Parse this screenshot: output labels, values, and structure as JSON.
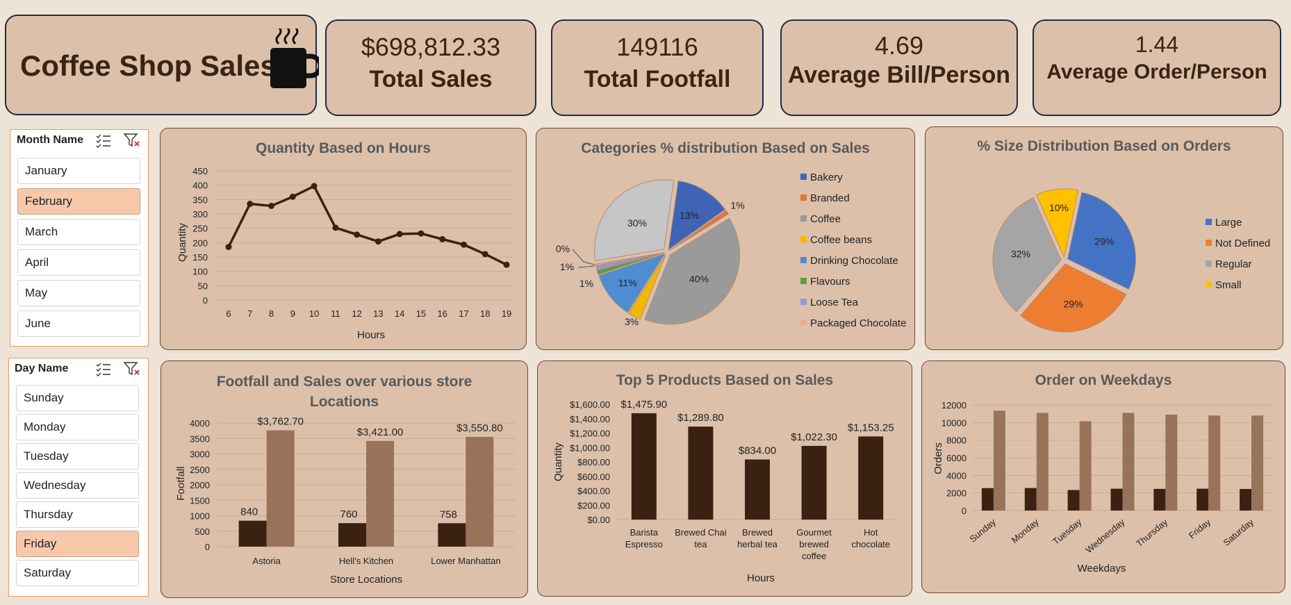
{
  "header": {
    "title": "Coffee Shop Sales",
    "icon": "coffee-mug-icon"
  },
  "kpis": {
    "total_sales": {
      "value": "$698,812.33",
      "label": "Total Sales"
    },
    "total_footfall": {
      "value": "149116",
      "label": "Total Footfall"
    },
    "avg_bill": {
      "value": "4.69",
      "label": "Average Bill/Person"
    },
    "avg_order": {
      "value": "1.44",
      "label": "Average Order/Person"
    }
  },
  "slicers": {
    "month": {
      "title": "Month Name",
      "items": [
        "January",
        "February",
        "March",
        "April",
        "May",
        "June"
      ],
      "selected": "February"
    },
    "day": {
      "title": "Day Name",
      "items": [
        "Sunday",
        "Monday",
        "Tuesday",
        "Wednesday",
        "Thursday",
        "Friday",
        "Saturday"
      ],
      "selected": "Friday"
    }
  },
  "colors": {
    "dark": "#3a2112",
    "light": "#98735a",
    "line": "#3a2112",
    "bakery": "#3f64b5",
    "branded": "#e0743a",
    "coffee": "#9a9a9a",
    "coffee_beans": "#f2b800",
    "drinking_chocolate": "#4e8dcf",
    "flavours": "#5f9e3a",
    "loose_tea": "#8d9bd9",
    "packaged_chocolate": "#f0a98a",
    "large": "#4472c4",
    "not_defined": "#ed7d31",
    "regular": "#a5a5a5",
    "small": "#ffc000"
  },
  "chart_data": [
    {
      "id": "hours",
      "type": "line",
      "title": "Quantity Based on Hours",
      "xlabel": "Hours",
      "ylabel": "Quantity",
      "x": [
        6,
        7,
        8,
        9,
        10,
        11,
        12,
        13,
        14,
        15,
        16,
        17,
        18,
        19
      ],
      "values": [
        185,
        335,
        328,
        360,
        397,
        252,
        228,
        204,
        230,
        232,
        212,
        193,
        160,
        123
      ],
      "ylim": [
        0,
        450
      ],
      "yticks": [
        0,
        50,
        100,
        150,
        200,
        250,
        300,
        350,
        400,
        450
      ],
      "grid": true
    },
    {
      "id": "categories",
      "type": "pie",
      "title": "Categories % distribution Based on Sales",
      "labels": [
        "Bakery",
        "Branded",
        "Coffee",
        "Coffee beans",
        "Drinking Chocolate",
        "Flavours",
        "Loose Tea",
        "Packaged Chocolate"
      ],
      "values": [
        13,
        1,
        40,
        3,
        11,
        1,
        1,
        0.4
      ],
      "data_labels": [
        "13%",
        "1%",
        "40%",
        "3%",
        "11%",
        "1%",
        "1%",
        "0%"
      ],
      "other": {
        "label": "",
        "value": 30,
        "data_label": "30%"
      },
      "legend": "right"
    },
    {
      "id": "sizes",
      "type": "pie",
      "title": "% Size Distribution Based on Orders",
      "labels": [
        "Large",
        "Not Defined",
        "Regular",
        "Small"
      ],
      "values": [
        29,
        29,
        32,
        10
      ],
      "data_labels": [
        "29%",
        "29%",
        "32%",
        "10%"
      ],
      "legend": "right"
    },
    {
      "id": "stores",
      "type": "bar",
      "title": "Footfall and Sales over various store Locations",
      "xlabel": "Store Locations",
      "ylabel": "Footfall",
      "categories": [
        "Astoria",
        "Hell's Kitchen",
        "Lower Manhattan"
      ],
      "series": [
        {
          "values": [
            840,
            760,
            758
          ],
          "labels": [
            "840",
            "760",
            "758"
          ]
        },
        {
          "values": [
            3762.7,
            3421.0,
            3550.8
          ],
          "labels": [
            "$3,762.70",
            "$3,421.00",
            "$3,550.80"
          ]
        }
      ],
      "ylim": [
        0,
        4000
      ],
      "yticks": [
        0,
        500,
        1000,
        1500,
        2000,
        2500,
        3000,
        3500,
        4000
      ],
      "grid": true
    },
    {
      "id": "products",
      "type": "bar",
      "title": "Top 5 Products Based on Sales",
      "xlabel": "Hours",
      "ylabel": "Quantity",
      "categories": [
        [
          "Barista",
          "Espresso"
        ],
        [
          "Brewed Chai",
          "tea"
        ],
        [
          "Brewed",
          "herbal tea"
        ],
        [
          "Gourmet",
          "brewed",
          "coffee"
        ],
        [
          "Hot",
          "chocolate"
        ]
      ],
      "values": [
        1475.9,
        1289.8,
        834.0,
        1022.3,
        1153.25
      ],
      "data_labels": [
        "$1,475.90",
        "$1,289.80",
        "$834.00",
        "$1,022.30",
        "$1,153.25"
      ],
      "ylim": [
        0,
        1600
      ],
      "yticks": [
        "$0.00",
        "$200.00",
        "$400.00",
        "$600.00",
        "$800.00",
        "$1,000.00",
        "$1,200.00",
        "$1,400.00",
        "$1,600.00"
      ],
      "grid": false
    },
    {
      "id": "weekdays",
      "type": "bar",
      "title": "Order on Weekdays",
      "xlabel": "Weekdays",
      "ylabel": "Orders",
      "categories": [
        "Sunday",
        "Monday",
        "Tuesday",
        "Wednesday",
        "Thursday",
        "Friday",
        "Saturday"
      ],
      "series": [
        {
          "values": [
            2550,
            2560,
            2330,
            2480,
            2460,
            2480,
            2450
          ]
        },
        {
          "values": [
            11350,
            11100,
            10150,
            11100,
            10900,
            10800,
            10800
          ]
        }
      ],
      "ylim": [
        0,
        12000
      ],
      "yticks": [
        0,
        2000,
        4000,
        6000,
        8000,
        10000,
        12000
      ],
      "grid": true
    }
  ]
}
